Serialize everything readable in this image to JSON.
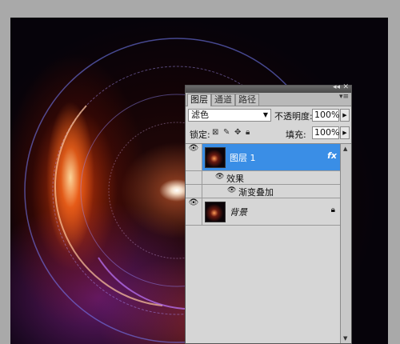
{
  "panel": {
    "tabs": [
      {
        "label": "图层",
        "active": true
      },
      {
        "label": "通道",
        "active": false
      },
      {
        "label": "路径",
        "active": false
      }
    ],
    "blend_mode": "滤色",
    "opacity_label": "不透明度:",
    "opacity_value": "100%",
    "lock_label": "锁定:",
    "fill_label": "填充:",
    "fill_value": "100%",
    "layers": [
      {
        "name": "图层 1",
        "selected": true,
        "has_fx": true,
        "fx_label": "fx"
      },
      {
        "name": "背景",
        "selected": false,
        "locked": true
      }
    ],
    "effects_label": "效果",
    "gradient_overlay_label": "渐变叠加",
    "colors": {
      "selection": "#3a8ee6",
      "panel_bg": "#d6d6d6"
    }
  }
}
